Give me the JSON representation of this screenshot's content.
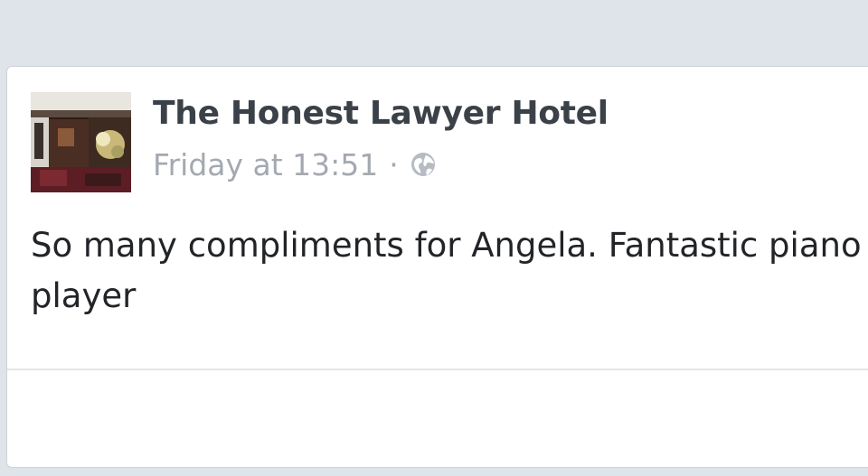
{
  "post": {
    "page_name": "The Honest Lawyer Hotel",
    "timestamp": "Friday at 13:51",
    "separator": "·",
    "privacy_icon": "globe-icon",
    "text": "So many compliments for Angela. Fantastic piano player"
  },
  "colors": {
    "feed_background": "#dfe3ea",
    "card_background": "#ffffff",
    "name_text": "#3b4148",
    "meta_text": "#a4a9b1",
    "body_text": "#222428"
  }
}
